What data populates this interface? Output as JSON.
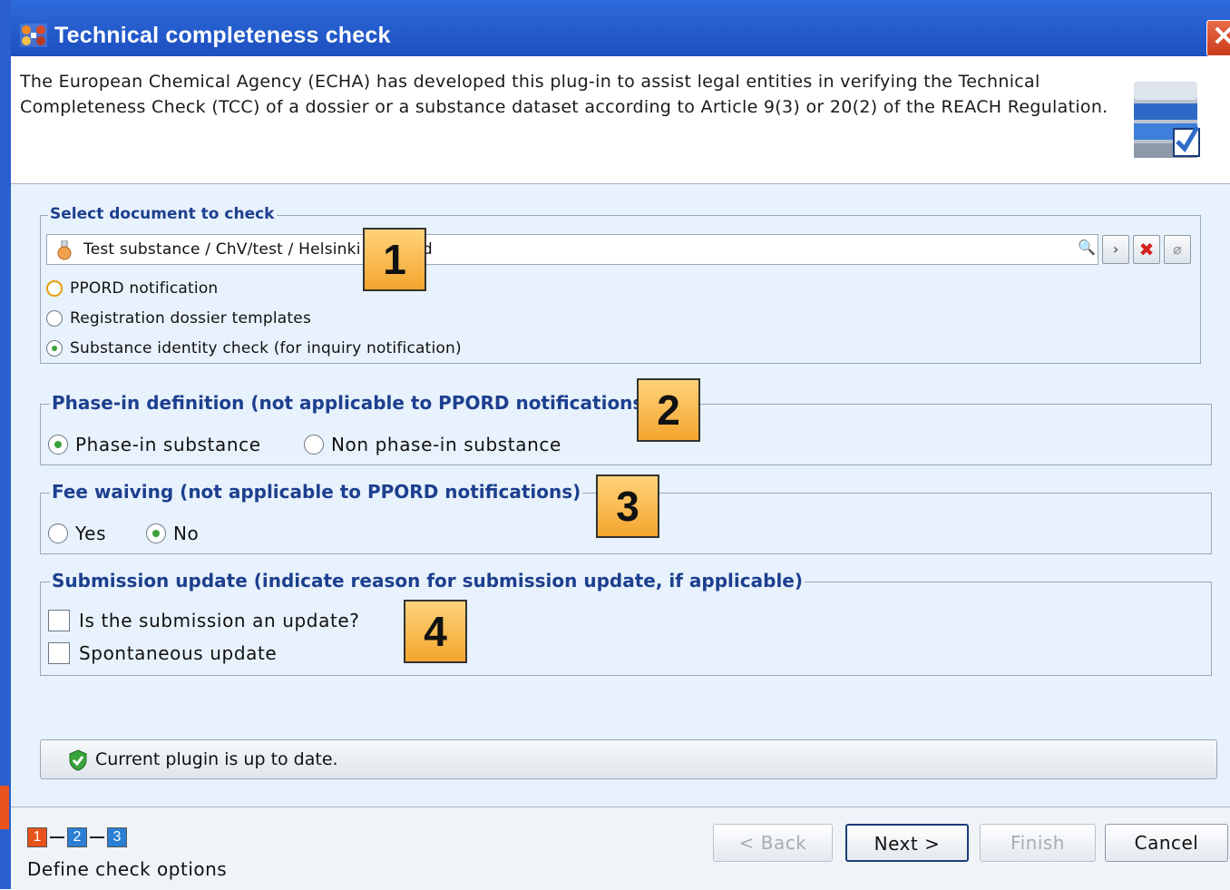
{
  "window": {
    "title": "Technical completeness check",
    "close_label": "✕"
  },
  "header": {
    "description": "The European Chemical Agency (ECHA) has developed this plug-in to assist legal entities in verifying the Technical Completeness Check (TCC) of a dossier or a substance dataset according to Article 9(3) or 20(2) of the REACH Regulation."
  },
  "select_document": {
    "legend": "Select document to check",
    "document_value": "Test substance / ChV/test / Helsinki / Finland",
    "options": [
      {
        "label": "PPORD notification",
        "checked": false
      },
      {
        "label": "Registration dossier templates",
        "checked": false
      },
      {
        "label": "Substance identity check (for inquiry notification)",
        "checked": true
      }
    ]
  },
  "phase_in": {
    "legend": "Phase-in definition (not applicable to PPORD notifications)",
    "options": [
      {
        "label": "Phase-in substance",
        "checked": true
      },
      {
        "label": "Non phase-in substance",
        "checked": false
      }
    ]
  },
  "fee_waiving": {
    "legend": "Fee waiving (not applicable to PPORD notifications)",
    "options": [
      {
        "label": "Yes",
        "checked": false
      },
      {
        "label": "No",
        "checked": true
      }
    ]
  },
  "submission_update": {
    "legend": "Submission update (indicate reason for submission update, if applicable)",
    "checkboxes": [
      {
        "label": "Is the submission an update?",
        "checked": false
      },
      {
        "label": "Spontaneous update",
        "checked": false
      }
    ]
  },
  "callouts": [
    "1",
    "2",
    "3",
    "4"
  ],
  "status": {
    "text": "Current plugin is up to date."
  },
  "wizard": {
    "steps": [
      "1",
      "2",
      "3"
    ],
    "current_step": 1,
    "step_label": "Define check options"
  },
  "buttons": {
    "back": "< Back",
    "next": "Next >",
    "finish": "Finish",
    "cancel": "Cancel"
  },
  "colors": {
    "title_bar": "#2e6bdc",
    "legend_text": "#1d3f8f",
    "content_bg": "#e8f2fc",
    "callout_bg": "#f3a62e",
    "step_current": "#e8521b",
    "step_other": "#2a7fd4"
  }
}
